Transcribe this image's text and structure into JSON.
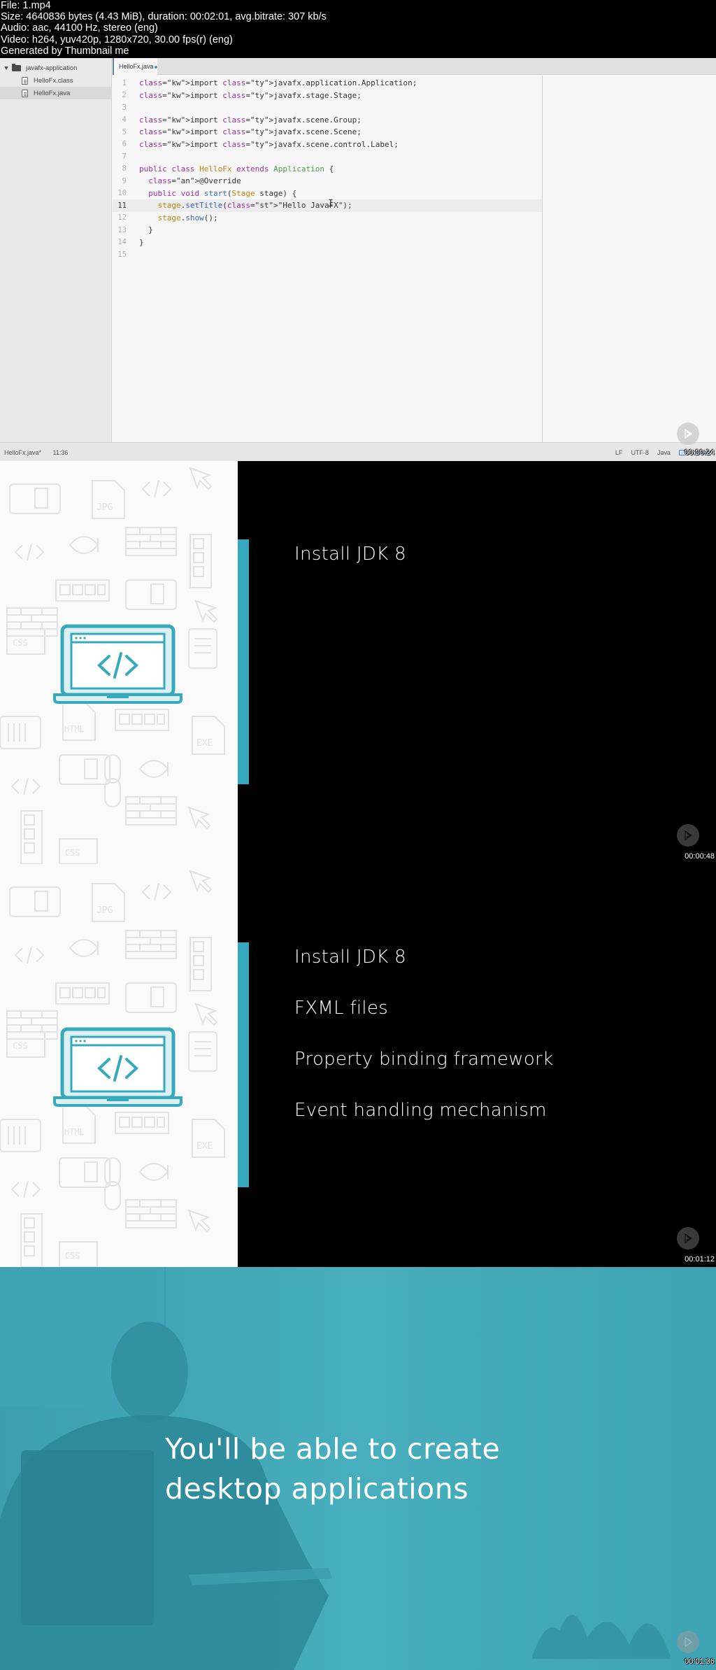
{
  "metadata": {
    "lines": [
      "File: 1.mp4",
      "Size: 4640836 bytes (4.43 MiB), duration: 00:02:01, avg.bitrate: 307 kb/s",
      "Audio: aac, 44100 Hz, stereo (eng)",
      "Video: h264, yuv420p, 1280x720, 30.00 fps(r) (eng)",
      "Generated by Thumbnail me"
    ]
  },
  "frames": [
    {
      "timestamp": "00:00:24",
      "ide": {
        "project_tree": {
          "root": "javafx-application",
          "files": [
            "HelloFx.class",
            "HelloFx.java"
          ],
          "selected": "HelloFx.java"
        },
        "tab": "HelloFx.java",
        "code_lines": [
          {
            "n": "1",
            "text": "import javafx.application.Application;"
          },
          {
            "n": "2",
            "text": "import javafx.stage.Stage;"
          },
          {
            "n": "3",
            "text": ""
          },
          {
            "n": "4",
            "text": "import javafx.scene.Group;"
          },
          {
            "n": "5",
            "text": "import javafx.scene.Scene;"
          },
          {
            "n": "6",
            "text": "import javafx.scene.control.Label;"
          },
          {
            "n": "7",
            "text": ""
          },
          {
            "n": "8",
            "text": "public class HelloFx extends Application {"
          },
          {
            "n": "9",
            "text": "  @Override"
          },
          {
            "n": "10",
            "text": "  public void start(Stage stage) {"
          },
          {
            "n": "11",
            "text": "    stage.setTitle(\"Hello JavaFX\");"
          },
          {
            "n": "12",
            "text": "    stage.show();"
          },
          {
            "n": "13",
            "text": "  }"
          },
          {
            "n": "14",
            "text": "}"
          },
          {
            "n": "15",
            "text": ""
          }
        ],
        "current_line": "11",
        "status": {
          "file": "HelloFx.java*",
          "cursor": "11:36",
          "line_ending": "LF",
          "encoding": "UTF-8",
          "grammar": "Java",
          "update": "1 update"
        }
      }
    },
    {
      "timestamp": "00:00:48",
      "bullets": [
        "Install JDK 8"
      ]
    },
    {
      "timestamp": "00:01:12",
      "bullets": [
        "Install JDK 8",
        "FXML files",
        "Property binding framework",
        "Event handling mechanism"
      ]
    },
    {
      "timestamp": "00:01:36",
      "headline_line1": "You'll be able to create",
      "headline_line2": "desktop applications"
    }
  ],
  "colors": {
    "accent_teal": "#36a9bc",
    "slide_bg": "#000000",
    "overlay_teal": "#42a8b8"
  }
}
